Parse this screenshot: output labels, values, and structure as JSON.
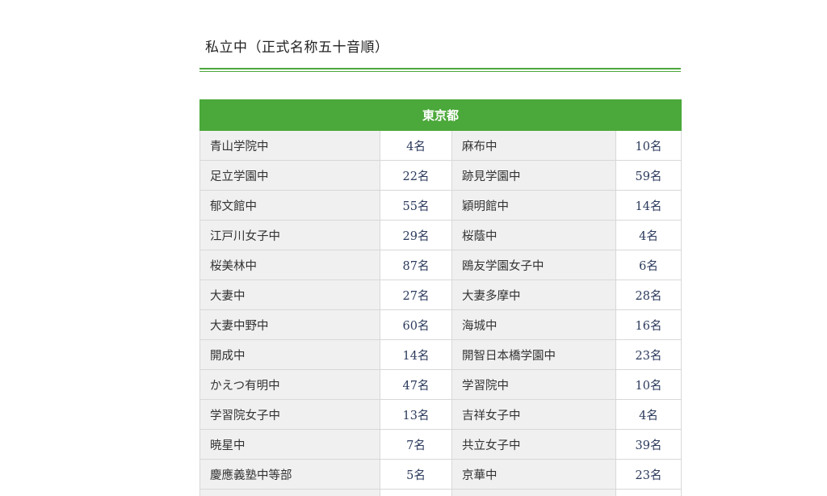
{
  "section": {
    "title": "私立中（正式名称五十音順）"
  },
  "table": {
    "header": "東京都",
    "rows": [
      {
        "left_school": "青山学院中",
        "left_count": "4名",
        "right_school": "麻布中",
        "right_count": "10名"
      },
      {
        "left_school": "足立学園中",
        "left_count": "22名",
        "right_school": "跡見学園中",
        "right_count": "59名"
      },
      {
        "left_school": "郁文館中",
        "left_count": "55名",
        "right_school": "穎明館中",
        "right_count": "14名"
      },
      {
        "left_school": "江戸川女子中",
        "left_count": "29名",
        "right_school": "桜蔭中",
        "right_count": "4名"
      },
      {
        "left_school": "桜美林中",
        "left_count": "87名",
        "right_school": "鴎友学園女子中",
        "right_count": "6名"
      },
      {
        "left_school": "大妻中",
        "left_count": "27名",
        "right_school": "大妻多摩中",
        "right_count": "28名"
      },
      {
        "left_school": "大妻中野中",
        "left_count": "60名",
        "right_school": "海城中",
        "right_count": "16名"
      },
      {
        "left_school": "開成中",
        "left_count": "14名",
        "right_school": "開智日本橋学園中",
        "right_count": "23名"
      },
      {
        "left_school": "かえつ有明中",
        "left_count": "47名",
        "right_school": "学習院中",
        "right_count": "10名"
      },
      {
        "left_school": "学習院女子中",
        "left_count": "13名",
        "right_school": "吉祥女子中",
        "right_count": "4名"
      },
      {
        "left_school": "暁星中",
        "left_count": "7名",
        "right_school": "共立女子中",
        "right_count": "39名"
      },
      {
        "left_school": "慶應義塾中等部",
        "left_count": "5名",
        "right_school": "京華中",
        "right_count": "23名"
      },
      {
        "left_school": "",
        "left_count": "",
        "right_school": "",
        "right_count": ""
      }
    ]
  },
  "colors": {
    "accent": "#4ba83a",
    "school_cell_bg": "#f0f0f0",
    "count_text": "#2b3a5c"
  }
}
